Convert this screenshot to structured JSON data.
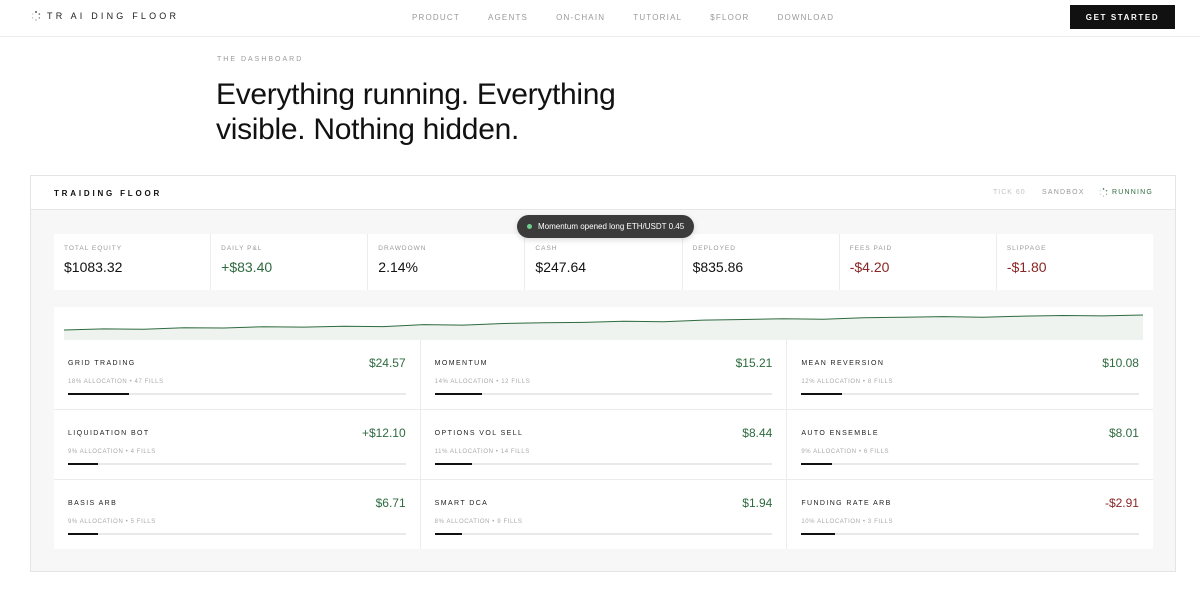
{
  "nav": {
    "logo": "TR AI DING FLOOR",
    "links": [
      "PRODUCT",
      "AGENTS",
      "ON-CHAIN",
      "TUTORIAL",
      "$FLOOR",
      "DOWNLOAD"
    ],
    "cta": "GET STARTED"
  },
  "hero": {
    "eyebrow": "THE DASHBOARD",
    "headline": "Everything running. Everything visible. Nothing hidden."
  },
  "panel": {
    "title": "TRAIDING FLOOR",
    "tick": "TICK 60",
    "mode": "SANDBOX",
    "status": "RUNNING",
    "toast": "Momentum opened long ETH/USDT 0.45",
    "stats": [
      {
        "label": "TOTAL EQUITY",
        "value": "$1083.32",
        "tone": "neutral"
      },
      {
        "label": "DAILY P&L",
        "value": "+$83.40",
        "tone": "pos"
      },
      {
        "label": "DRAWDOWN",
        "value": "2.14%",
        "tone": "neutral"
      },
      {
        "label": "CASH",
        "value": "$247.64",
        "tone": "neutral"
      },
      {
        "label": "DEPLOYED",
        "value": "$835.86",
        "tone": "neutral"
      },
      {
        "label": "FEES PAID",
        "value": "-$4.20",
        "tone": "neg"
      },
      {
        "label": "SLIPPAGE",
        "value": "-$1.80",
        "tone": "neg"
      }
    ],
    "strategies": [
      {
        "name": "GRID TRADING",
        "pnl": "$24.57",
        "meta": "18% ALLOCATION • 47 FILLS",
        "allocation": 0.18,
        "tone": "pos"
      },
      {
        "name": "MOMENTUM",
        "pnl": "$15.21",
        "meta": "14% ALLOCATION • 12 FILLS",
        "allocation": 0.14,
        "tone": "pos"
      },
      {
        "name": "MEAN REVERSION",
        "pnl": "$10.08",
        "meta": "12% ALLOCATION • 8 FILLS",
        "allocation": 0.12,
        "tone": "pos"
      },
      {
        "name": "LIQUIDATION BOT",
        "pnl": "+$12.10",
        "meta": "9% ALLOCATION • 4 FILLS",
        "allocation": 0.09,
        "tone": "pos"
      },
      {
        "name": "OPTIONS VOL SELL",
        "pnl": "$8.44",
        "meta": "11% ALLOCATION • 14 FILLS",
        "allocation": 0.11,
        "tone": "pos"
      },
      {
        "name": "AUTO ENSEMBLE",
        "pnl": "$8.01",
        "meta": "9% ALLOCATION • 6 FILLS",
        "allocation": 0.09,
        "tone": "pos"
      },
      {
        "name": "BASIS ARB",
        "pnl": "$6.71",
        "meta": "9% ALLOCATION • 5 FILLS",
        "allocation": 0.09,
        "tone": "pos"
      },
      {
        "name": "SMART DCA",
        "pnl": "$1.94",
        "meta": "8% ALLOCATION • 9 FILLS",
        "allocation": 0.08,
        "tone": "pos"
      },
      {
        "name": "FUNDING RATE ARB",
        "pnl": "-$2.91",
        "meta": "10% ALLOCATION • 3 FILLS",
        "allocation": 0.1,
        "tone": "neg"
      }
    ],
    "equity_curve": [
      1000,
      1006,
      1004,
      1012,
      1011,
      1018,
      1016,
      1021,
      1019,
      1030,
      1027,
      1036,
      1040,
      1042,
      1048,
      1046,
      1055,
      1058,
      1062,
      1060,
      1068,
      1071,
      1074,
      1070,
      1077,
      1080,
      1078,
      1083
    ],
    "colors": {
      "positive": "#2f6b3f",
      "negative": "#8a2626",
      "accent": "#111111"
    }
  }
}
